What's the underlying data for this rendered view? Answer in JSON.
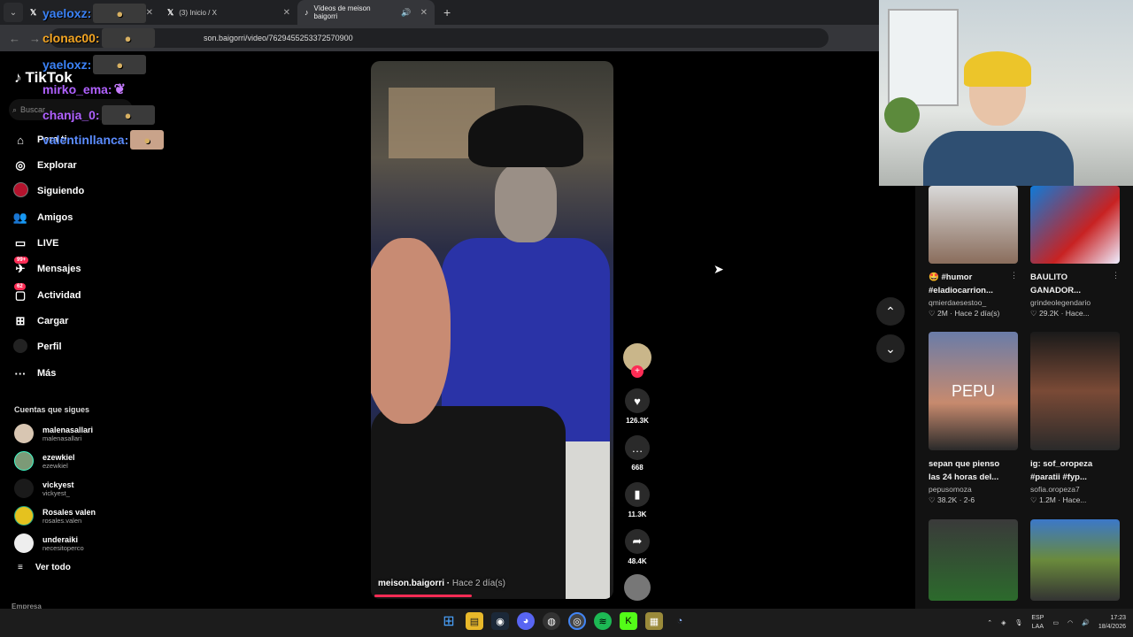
{
  "browser": {
    "tabs": [
      {
        "label": "",
        "favicon": "X"
      },
      {
        "label": "(3) Inicio / X",
        "favicon": "X"
      },
      {
        "label": "Vídeos de meison baigorri",
        "favicon": "tiktok",
        "active": true
      }
    ],
    "url": "son.baigorri/video/7629455253372570900"
  },
  "sidebar": {
    "logo": "TikTok",
    "search_placeholder": "Buscar",
    "nav": [
      {
        "label": "Para ti",
        "icon": "home-icon"
      },
      {
        "label": "Explorar",
        "icon": "compass-icon"
      },
      {
        "label": "Siguiendo",
        "icon": "following-icon"
      },
      {
        "label": "Amigos",
        "icon": "friends-icon"
      },
      {
        "label": "LIVE",
        "icon": "live-icon"
      },
      {
        "label": "Mensajes",
        "icon": "messages-icon",
        "badge": "99+"
      },
      {
        "label": "Actividad",
        "icon": "activity-icon",
        "badge": "62"
      },
      {
        "label": "Cargar",
        "icon": "upload-icon"
      },
      {
        "label": "Perfil",
        "icon": "profile-icon"
      },
      {
        "label": "Más",
        "icon": "more-icon"
      }
    ],
    "following_title": "Cuentas que sigues",
    "following": [
      {
        "name": "malenasallari",
        "handle": "malenasallari"
      },
      {
        "name": "ezewkiel",
        "handle": "ezewkiel"
      },
      {
        "name": "vickyest",
        "handle": "vickyest_"
      },
      {
        "name": "Rosales valen",
        "handle": "rosales.valen"
      },
      {
        "name": "underaiki",
        "handle": "necesitoperco"
      }
    ],
    "see_all": "Ver todo",
    "empresa": "Empresa"
  },
  "chat_overlay": [
    {
      "user": "yaeloxz:",
      "color": "#3b82f6"
    },
    {
      "user": "clonac00:",
      "color": "#f5a623"
    },
    {
      "user": "yaeloxz:",
      "color": "#3b82f6"
    },
    {
      "user": "mirko_ema:",
      "color": "#b061ff"
    },
    {
      "user": "chanja_0:",
      "color": "#b061ff"
    },
    {
      "user": "valentinllanca:",
      "color": "#5b8cff"
    }
  ],
  "video": {
    "author": "meison.baigorri",
    "time": "Hace 2 día(s)",
    "likes": "126.3K",
    "comments": "668",
    "saves": "11.3K",
    "shares": "48.4K",
    "progress": 0.4
  },
  "recommended": [
    {
      "title_line1": "🤩 #humor",
      "title_line2": "#eladiocarrion...",
      "user": "qmierdaesestoo_",
      "likes": "2M",
      "time": "Hace 2 día(s)"
    },
    {
      "title_line1": "BAULITO",
      "title_line2": "GANADOR...",
      "user": "grindeolegendario",
      "likes": "29.2K",
      "time": "Hace..."
    },
    {
      "title_line1": "sepan que pienso",
      "title_line2": "las 24 horas del...",
      "user": "pepusomoza",
      "likes": "38.2K",
      "time": "2-6",
      "overlay": "PEPU"
    },
    {
      "title_line1": "ig: sof_oropeza",
      "title_line2": "#paratii #fyp...",
      "user": "sofia.oropeza7",
      "likes": "1.2M",
      "time": "Hace..."
    }
  ],
  "taskbar": {
    "lang1": "ESP",
    "lang2": "LAA",
    "time": "17:23",
    "date": "18/4/2026"
  },
  "colors": {
    "accent": "#fe2c55"
  }
}
